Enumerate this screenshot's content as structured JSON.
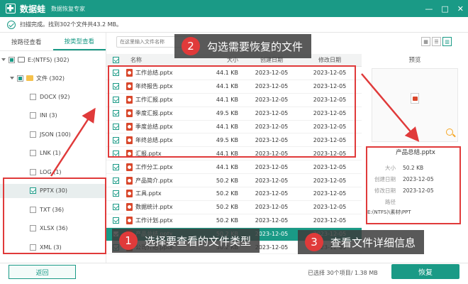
{
  "app": {
    "name": "数据蛙",
    "subtitle": "数据恢复专家"
  },
  "window_controls": [
    "—",
    "□",
    "✕"
  ],
  "status": {
    "text": "扫描完成。找到302个文件共43.2 MB。"
  },
  "left_tabs": [
    "按路径查看",
    "按类型查看"
  ],
  "left_tabs_active": 1,
  "tree": {
    "drive": "E:(NTFS) (302)",
    "folder": "文件 (302)",
    "types": [
      {
        "label": "DOCX (92)",
        "checked": false
      },
      {
        "label": "INI (3)",
        "checked": false
      },
      {
        "label": "JSON (100)",
        "checked": false
      },
      {
        "label": "LNK (1)",
        "checked": false
      },
      {
        "label": "LOG (1)",
        "checked": false
      },
      {
        "label": "PPTX (30)",
        "checked": true
      },
      {
        "label": "TXT (36)",
        "checked": false
      },
      {
        "label": "XLSX (36)",
        "checked": false
      },
      {
        "label": "XML (3)",
        "checked": false
      }
    ]
  },
  "search": {
    "placeholder": "在这里输入文件名称"
  },
  "table": {
    "headers": [
      "名称",
      "大小",
      "创建日期",
      "修改日期"
    ],
    "rows": [
      {
        "name": "工作总结.pptx",
        "size": "44.1 KB",
        "created": "2023-12-05",
        "modified": "2023-12-05"
      },
      {
        "name": "年终报告.pptx",
        "size": "44.1 KB",
        "created": "2023-12-05",
        "modified": "2023-12-05"
      },
      {
        "name": "工作汇报.pptx",
        "size": "44.1 KB",
        "created": "2023-12-05",
        "modified": "2023-12-05"
      },
      {
        "name": "季度汇报.pptx",
        "size": "49.5 KB",
        "created": "2023-12-05",
        "modified": "2023-12-05"
      },
      {
        "name": "季度总结.pptx",
        "size": "44.1 KB",
        "created": "2023-12-05",
        "modified": "2023-12-05"
      },
      {
        "name": "年终总结.pptx",
        "size": "49.5 KB",
        "created": "2023-12-05",
        "modified": "2023-12-05"
      },
      {
        "name": "汇报.pptx",
        "size": "44.1 KB",
        "created": "2023-12-05",
        "modified": "2023-12-05"
      },
      {
        "name": "工作分工.pptx",
        "size": "44.1 KB",
        "created": "2023-12-05",
        "modified": "2023-12-05"
      },
      {
        "name": "产品简介.pptx",
        "size": "50.2 KB",
        "created": "2023-12-05",
        "modified": "2023-12-05"
      },
      {
        "name": "工具.pptx",
        "size": "50.2 KB",
        "created": "2023-12-05",
        "modified": "2023-12-05"
      },
      {
        "name": "数据统计.pptx",
        "size": "50.2 KB",
        "created": "2023-12-05",
        "modified": "2023-12-05"
      },
      {
        "name": "工作计划.pptx",
        "size": "50.2 KB",
        "created": "2023-12-05",
        "modified": "2023-12-05"
      },
      {
        "name": "产品总结.pptx",
        "size": "50.2 KB",
        "created": "2023-12-05",
        "modified": "2023-12-05"
      },
      {
        "name": "公司介绍.pptx",
        "size": "50.2 KB",
        "created": "2023-12-05",
        "modified": "2023-12-05"
      }
    ]
  },
  "preview": {
    "title": "预览",
    "file_name": "产品总结.pptx",
    "labels": {
      "size": "大小",
      "created": "创建日期",
      "modified": "修改日期",
      "path": "路径"
    },
    "size": "50.2 KB",
    "created": "2023-12-05",
    "modified": "2023-12-05",
    "path": "E:(NTFS)\\素材\\PPT"
  },
  "bottom": {
    "back_label": "返回",
    "selection_text": "已选择 30个项目/ 1.38 MB",
    "restore_label": "恢复"
  },
  "annotations": [
    {
      "num": "1",
      "text": "选择要查看的文件类型"
    },
    {
      "num": "2",
      "text": "勾选需要恢复的文件"
    },
    {
      "num": "3",
      "text": "查看文件详细信息"
    }
  ],
  "colors": {
    "brand": "#1a9a86",
    "annotation_red": "#e03a3a",
    "ppt_icon": "#d9472b"
  }
}
